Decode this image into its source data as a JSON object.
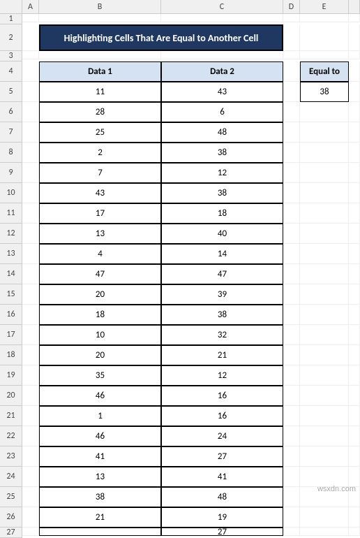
{
  "columns": [
    "",
    "A",
    "B",
    "C",
    "D",
    "E",
    ""
  ],
  "row_numbers": [
    1,
    2,
    3,
    4,
    5,
    6,
    7,
    8,
    9,
    10,
    11,
    12,
    13,
    14,
    15,
    16,
    17,
    18,
    19,
    20,
    21,
    22,
    23,
    24,
    25,
    26,
    27
  ],
  "title": "Highlighting Cells That Are Equal to Another Cell",
  "headers": {
    "data1": "Data 1",
    "data2": "Data 2",
    "equalto": "Equal to"
  },
  "equal_value": "38",
  "data": [
    {
      "d1": "11",
      "d2": "43"
    },
    {
      "d1": "28",
      "d2": "6"
    },
    {
      "d1": "25",
      "d2": "48"
    },
    {
      "d1": "2",
      "d2": "38"
    },
    {
      "d1": "7",
      "d2": "12"
    },
    {
      "d1": "43",
      "d2": "38"
    },
    {
      "d1": "17",
      "d2": "18"
    },
    {
      "d1": "13",
      "d2": "40"
    },
    {
      "d1": "4",
      "d2": "14"
    },
    {
      "d1": "47",
      "d2": "47"
    },
    {
      "d1": "20",
      "d2": "39"
    },
    {
      "d1": "18",
      "d2": "38"
    },
    {
      "d1": "10",
      "d2": "32"
    },
    {
      "d1": "20",
      "d2": "21"
    },
    {
      "d1": "35",
      "d2": "12"
    },
    {
      "d1": "46",
      "d2": "16"
    },
    {
      "d1": "1",
      "d2": "16"
    },
    {
      "d1": "46",
      "d2": "24"
    },
    {
      "d1": "41",
      "d2": "27"
    },
    {
      "d1": "13",
      "d2": "41"
    },
    {
      "d1": "38",
      "d2": "48"
    },
    {
      "d1": "21",
      "d2": "19"
    },
    {
      "d1": "",
      "d2": "27"
    }
  ],
  "watermark": "wsxdn.com",
  "chart_data": {
    "type": "table",
    "title": "Highlighting Cells That Are Equal to Another Cell",
    "columns": [
      "Data 1",
      "Data 2"
    ],
    "rows": [
      [
        11,
        43
      ],
      [
        28,
        6
      ],
      [
        25,
        48
      ],
      [
        2,
        38
      ],
      [
        7,
        12
      ],
      [
        43,
        38
      ],
      [
        17,
        18
      ],
      [
        13,
        40
      ],
      [
        4,
        14
      ],
      [
        47,
        47
      ],
      [
        20,
        39
      ],
      [
        18,
        38
      ],
      [
        10,
        32
      ],
      [
        20,
        21
      ],
      [
        35,
        12
      ],
      [
        46,
        16
      ],
      [
        1,
        16
      ],
      [
        46,
        24
      ],
      [
        41,
        27
      ],
      [
        13,
        41
      ],
      [
        38,
        48
      ],
      [
        21,
        19
      ]
    ],
    "annotation": {
      "Equal to": 38
    }
  }
}
